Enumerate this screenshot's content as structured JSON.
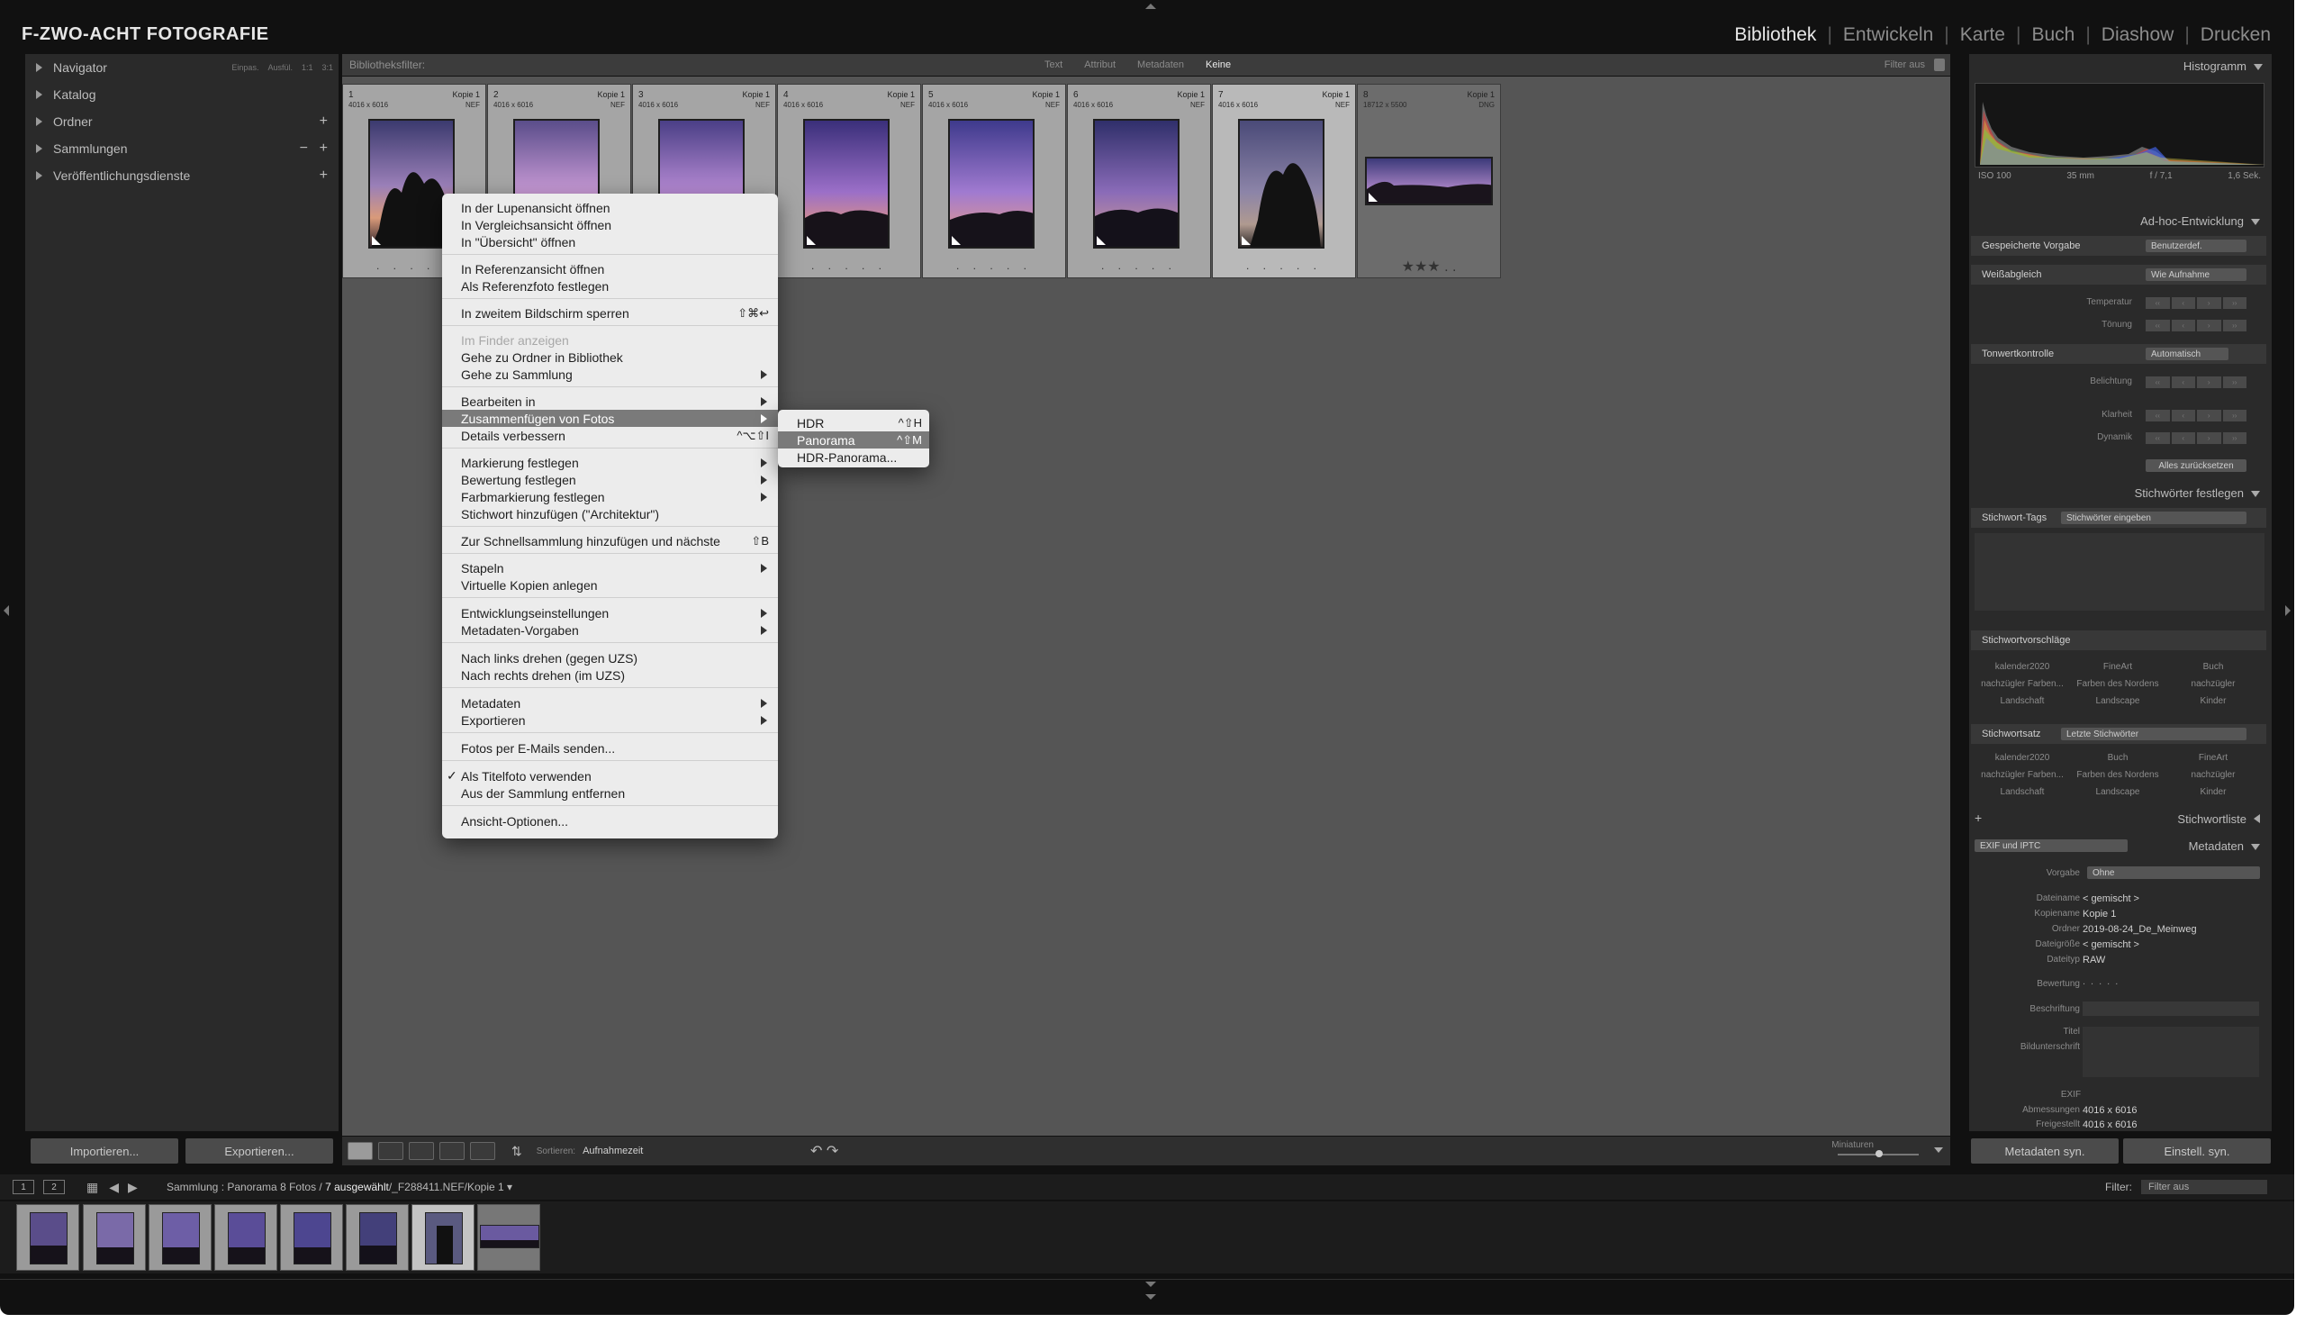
{
  "app": {
    "identity": "F-ZWO-ACHT FOTOGRAFIE",
    "modules": [
      "Bibliothek",
      "Entwickeln",
      "Karte",
      "Buch",
      "Diashow",
      "Drucken"
    ]
  },
  "left_panel": {
    "navigator": "Navigator",
    "navigator_zoom": [
      "Einpas.",
      "Ausfül.",
      "1:1",
      "3:1"
    ],
    "catalog": "Katalog",
    "folders": "Ordner",
    "collections": "Sammlungen",
    "publish": "Veröffentlichungsdienste",
    "import_button": "Importieren...",
    "export_button": "Exportieren..."
  },
  "filter_bar": {
    "label": "Bibliotheksfilter:",
    "options": [
      "Text",
      "Attribut",
      "Metadaten",
      "Keine"
    ],
    "filter_off": "Filter aus"
  },
  "grid": {
    "cells": [
      {
        "index": "1",
        "dims": "4016 x 6016",
        "copy": "Kopie 1",
        "ext": "NEF",
        "rating": ". . . . ."
      },
      {
        "index": "2",
        "dims": "4016 x 6016",
        "copy": "Kopie 1",
        "ext": "NEF",
        "rating": ". . . . ."
      },
      {
        "index": "3",
        "dims": "4016 x 6016",
        "copy": "Kopie 1",
        "ext": "NEF",
        "rating": ". . . . ."
      },
      {
        "index": "4",
        "dims": "4016 x 6016",
        "copy": "Kopie 1",
        "ext": "NEF",
        "rating": ". . . . ."
      },
      {
        "index": "5",
        "dims": "4016 x 6016",
        "copy": "Kopie 1",
        "ext": "NEF",
        "rating": ". . . . ."
      },
      {
        "index": "6",
        "dims": "4016 x 6016",
        "copy": "Kopie 1",
        "ext": "NEF",
        "rating": ". . . . ."
      },
      {
        "index": "7",
        "dims": "4016 x 6016",
        "copy": "Kopie 1",
        "ext": "NEF",
        "rating": ". . . . ."
      },
      {
        "index": "8",
        "dims": "18712 x 5500",
        "copy": "Kopie 1",
        "ext": "DNG",
        "rating": "★★★ . ."
      }
    ]
  },
  "toolbar": {
    "sort_label": "Sortieren:",
    "sort_value": "Aufnahmezeit",
    "thumbs_label": "Miniaturen"
  },
  "context_menu": {
    "items": [
      {
        "label": "In der Lupenansicht öffnen"
      },
      {
        "label": "In Vergleichsansicht öffnen"
      },
      {
        "label": "In \"Übersicht\" öffnen"
      },
      {
        "label": "In Referenzansicht öffnen"
      },
      {
        "label": "Als Referenzfoto festlegen"
      },
      {
        "label": "In zweitem Bildschirm sperren",
        "shortcut": "⇧⌘↩"
      },
      {
        "label": "Im Finder anzeigen"
      },
      {
        "label": "Gehe zu Ordner in Bibliothek"
      },
      {
        "label": "Gehe zu Sammlung"
      },
      {
        "label": "Bearbeiten in"
      },
      {
        "label": "Zusammenfügen von Fotos"
      },
      {
        "label": "Details verbessern",
        "shortcut": "^⌥⇧I"
      },
      {
        "label": "Markierung festlegen"
      },
      {
        "label": "Bewertung festlegen"
      },
      {
        "label": "Farbmarkierung festlegen"
      },
      {
        "label": "Stichwort hinzufügen (\"Architektur\")"
      },
      {
        "label": "Zur Schnellsammlung hinzufügen und nächste",
        "shortcut": "⇧B"
      },
      {
        "label": "Stapeln"
      },
      {
        "label": "Virtuelle Kopien anlegen"
      },
      {
        "label": "Entwicklungseinstellungen"
      },
      {
        "label": "Metadaten-Vorgaben"
      },
      {
        "label": "Nach links drehen (gegen UZS)"
      },
      {
        "label": "Nach rechts drehen (im UZS)"
      },
      {
        "label": "Metadaten"
      },
      {
        "label": "Exportieren"
      },
      {
        "label": "Fotos per E-Mails senden..."
      },
      {
        "label": "Als Titelfoto verwenden",
        "check": "✓"
      },
      {
        "label": "Aus der Sammlung entfernen"
      },
      {
        "label": "Ansicht-Optionen..."
      }
    ]
  },
  "submenu": {
    "items": [
      {
        "label": "HDR",
        "shortcut": "^⇧H"
      },
      {
        "label": "Panorama",
        "shortcut": "^⇧M"
      },
      {
        "label": "HDR-Panorama..."
      }
    ]
  },
  "right_panel": {
    "histogram_title": "Histogramm",
    "histogram_info": [
      "ISO 100",
      "35 mm",
      "f / 7,1",
      "1,6 Sek."
    ],
    "quick_develop": {
      "title": "Ad-hoc-Entwicklung",
      "saved_preset_label": "Gespeicherte Vorgabe",
      "saved_preset_value": "Benutzerdef.",
      "wb_label": "Weißabgleich",
      "wb_value": "Wie Aufnahme",
      "temperature": "Temperatur",
      "tint": "Tönung",
      "tone_label": "Tonwertkontrolle",
      "tone_value": "Automatisch",
      "exposure": "Belichtung",
      "clarity": "Klarheit",
      "vibrance": "Dynamik",
      "reset": "Alles zurücksetzen"
    },
    "keywording": {
      "title": "Stichwörter festlegen",
      "tags_label": "Stichwort-Tags",
      "tags_value": "Stichwörter eingeben",
      "suggestions_label": "Stichwortvorschläge",
      "suggestions": [
        "kalender2020",
        "FineArt",
        "Buch",
        "nachzügler Farben...",
        "Farben des Nordens",
        "nachzügler",
        "Landschaft",
        "Landscape",
        "Kinder"
      ],
      "set_label": "Stichwortsatz",
      "set_value": "Letzte Stichwörter",
      "set_keywords": [
        "kalender2020",
        "Buch",
        "FineArt",
        "nachzügler Farben...",
        "Farben des Nordens",
        "nachzügler",
        "Landschaft",
        "Landscape",
        "Kinder"
      ]
    },
    "keyword_list": "Stichwortliste",
    "metadata": {
      "title": "Metadaten",
      "set_select": "EXIF und IPTC",
      "preset_label": "Vorgabe",
      "preset_value": "Ohne",
      "fields": [
        {
          "label": "Dateiname",
          "value": "< gemischt >"
        },
        {
          "label": "Kopiename",
          "value": "Kopie 1"
        },
        {
          "label": "Ordner",
          "value": "2019-08-24_De_Meinweg"
        },
        {
          "label": "Dateigröße",
          "value": "< gemischt >"
        },
        {
          "label": "Dateityp",
          "value": "RAW"
        }
      ],
      "rating_label": "Bewertung",
      "caption_label": "Beschriftung",
      "title_label": "Titel",
      "caption2_label": "Bildunterschrift",
      "exif_label": "EXIF",
      "dims_label": "Abmessungen",
      "dims_value": "4016 x 6016",
      "crop_label": "Freigestellt",
      "crop_value": "4016 x 6016"
    },
    "sync_metadata": "Metadaten syn.",
    "sync_settings": "Einstell. syn."
  },
  "filmstrip": {
    "monitor1": "1",
    "monitor2": "2",
    "source_prefix": "Sammlung : Panorama",
    "source_count": "8 Fotos /",
    "source_selected": "7 ausgewählt",
    "source_file": "/_F288411.NEF/Kopie 1",
    "filter_label": "Filter:",
    "filter_value": "Filter aus"
  },
  "colors": {
    "accent_highlight": "#7a7a7a",
    "panel_bg": "#2a2a2a",
    "grid_bg": "#555555"
  }
}
